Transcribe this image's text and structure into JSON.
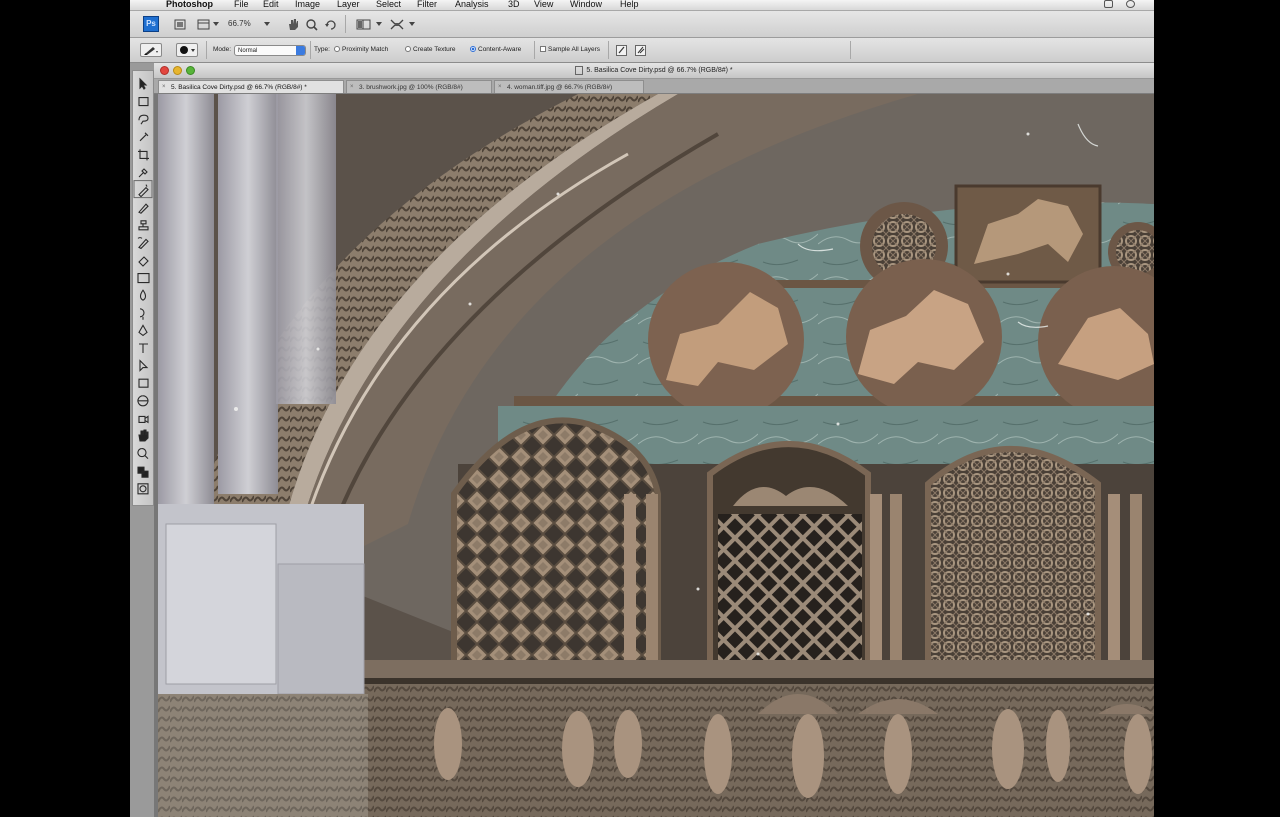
{
  "menubar": {
    "items": [
      "Photoshop",
      "File",
      "Edit",
      "Image",
      "Layer",
      "Select",
      "Filter",
      "Analysis",
      "3D",
      "View",
      "Window",
      "Help"
    ]
  },
  "appbar": {
    "zoom": "66.7%"
  },
  "options": {
    "mode_label": "Mode:",
    "mode_value": "Normal",
    "type_label": "Type:",
    "type_options": [
      "Proximity Match",
      "Create Texture",
      "Content-Aware"
    ],
    "type_selected": "Content-Aware",
    "sample_all_layers": "Sample All Layers"
  },
  "document": {
    "title": "5. Basilica Cove Dirty.psd @ 66.7% (RGB/8#) *",
    "tabs": [
      {
        "label": "5. Basilica Cove Dirty.psd @ 66.7% (RGB/8#) *",
        "active": true
      },
      {
        "label": "3. brushwork.jpg @ 100% (RGB/8#)",
        "active": false
      },
      {
        "label": "4. woman.tiff.jpg @ 66.7% (RGB/8#)",
        "active": false
      }
    ]
  },
  "colors": {
    "accent": "#2d6fd8",
    "close": "#e2463f",
    "minimize": "#e7b52d",
    "zoom": "#58b43a"
  },
  "tools": [
    "move-tool",
    "marquee-tool",
    "lasso-tool",
    "quick-select-tool",
    "crop-tool",
    "eyedropper-tool",
    "spot-healing-brush-tool",
    "brush-tool",
    "clone-stamp-tool",
    "history-brush-tool",
    "eraser-tool",
    "gradient-tool",
    "blur-tool",
    "dodge-tool",
    "pen-tool",
    "type-tool",
    "path-select-tool",
    "shape-tool",
    "3d-rotate-tool",
    "3d-camera-tool",
    "hand-tool",
    "zoom-tool",
    "color-swatches",
    "quick-mask-mode"
  ]
}
